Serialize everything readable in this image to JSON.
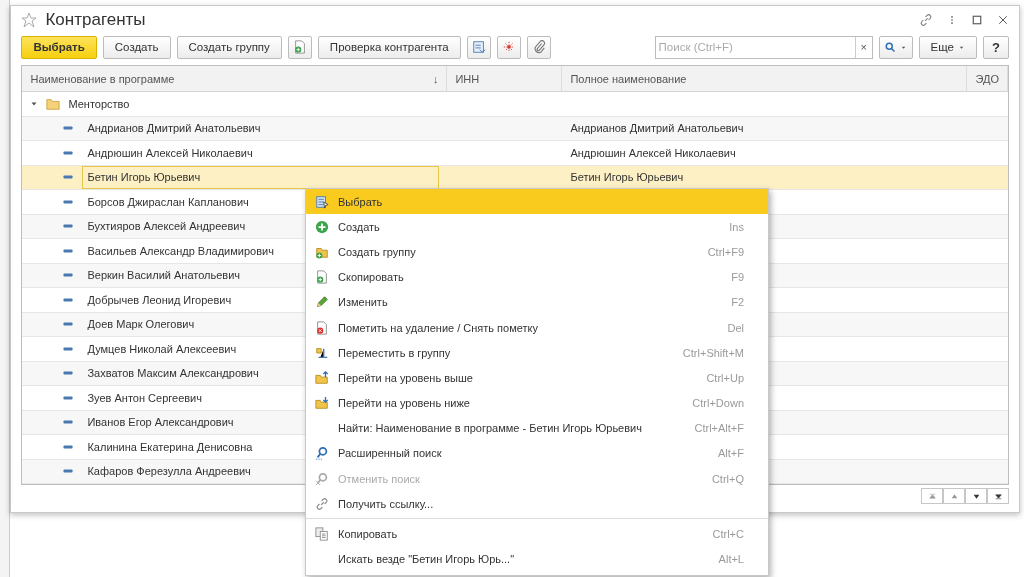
{
  "window": {
    "title": "Контрагенты",
    "favorite": false
  },
  "toolbar": {
    "buttons": [
      {
        "label": "Выбрать",
        "kind": "primary"
      },
      {
        "label": "Создать",
        "kind": "text"
      },
      {
        "label": "Создать группу",
        "kind": "text"
      },
      {
        "kind": "copy"
      },
      {
        "label": "Проверка контрагента",
        "kind": "text"
      },
      {
        "kind": "report"
      },
      {
        "kind": "structure"
      },
      {
        "kind": "attach"
      }
    ],
    "search": {
      "placeholder": "Поиск (Ctrl+F)",
      "clear": "×"
    },
    "more": "Еще",
    "help": "?"
  },
  "table": {
    "columns": [
      "Наименование в программе",
      "ИНН",
      "Полное наименование",
      "ЭДО"
    ],
    "sort_mark": "↓",
    "group": {
      "name": "Менторство",
      "expanded": true
    },
    "rows": [
      {
        "name": "Андрианов Дмитрий Анатольевич",
        "full": "Андрианов Дмитрий Анатольевич",
        "selected": false
      },
      {
        "name": "Андрюшин Алексей Николаевич",
        "full": "Андрюшин Алексей Николаевич",
        "selected": false
      },
      {
        "name": "Бетин Игорь Юрьевич",
        "full": "Бетин Игорь Юрьевич",
        "selected": true
      },
      {
        "name": "Борсов Джираслан Капланович",
        "selected": false
      },
      {
        "name": "Бухтияров Алексей Андреевич",
        "selected": false
      },
      {
        "name": "Васильев Александр Владимирович",
        "selected": false
      },
      {
        "name": "Веркин Василий Анатольевич",
        "selected": false
      },
      {
        "name": "Добрычев Леонид Игоревич",
        "selected": false
      },
      {
        "name": "Доев Марк Олегович",
        "selected": false
      },
      {
        "name": "Думцев Николай Алексеевич",
        "selected": false
      },
      {
        "name": "Захватов Максим Александрович",
        "selected": false
      },
      {
        "name": "Зуев Антон Сергеевич",
        "selected": false
      },
      {
        "name": "Иванов Егор Александрович",
        "selected": false
      },
      {
        "name": "Калинина Екатерина Денисовна",
        "selected": false
      },
      {
        "name": "Кафаров Ферезулла Андреевич",
        "selected": false
      }
    ]
  },
  "context_menu": [
    {
      "kind": "item",
      "label": "Выбрать",
      "selected": true,
      "disabled": false
    },
    {
      "kind": "item",
      "label": "Создать",
      "shortcut": "Ins",
      "selected": false,
      "disabled": false
    },
    {
      "kind": "item",
      "label": "Создать группу",
      "shortcut": "Ctrl+F9",
      "selected": false,
      "disabled": false
    },
    {
      "kind": "item",
      "label": "Скопировать",
      "shortcut": "F9",
      "selected": false,
      "disabled": false
    },
    {
      "kind": "item",
      "label": "Изменить",
      "shortcut": "F2",
      "selected": false,
      "disabled": false
    },
    {
      "kind": "item",
      "label": "Пометить на удаление / Снять пометку",
      "shortcut": "Del",
      "selected": false,
      "disabled": false
    },
    {
      "kind": "item",
      "label": "Переместить в группу",
      "shortcut": "Ctrl+Shift+M",
      "selected": false,
      "disabled": false
    },
    {
      "kind": "item",
      "label": "Перейти на уровень выше",
      "shortcut": "Ctrl+Up",
      "selected": false,
      "disabled": false
    },
    {
      "kind": "item",
      "label": "Перейти на уровень ниже",
      "shortcut": "Ctrl+Down",
      "selected": false,
      "disabled": false
    },
    {
      "kind": "item",
      "label": "Найти: Наименование в программе - Бетин Игорь Юрьевич",
      "shortcut": "Ctrl+Alt+F",
      "selected": false,
      "disabled": false
    },
    {
      "kind": "item",
      "label": "Расширенный поиск",
      "shortcut": "Alt+F",
      "selected": false,
      "disabled": false
    },
    {
      "kind": "item",
      "label": "Отменить поиск",
      "shortcut": "Ctrl+Q",
      "selected": false,
      "disabled": true
    },
    {
      "kind": "item",
      "label": "Получить ссылку...",
      "selected": false,
      "disabled": false
    },
    {
      "kind": "separator"
    },
    {
      "kind": "item",
      "label": "Копировать",
      "shortcut": "Ctrl+C",
      "selected": false,
      "disabled": false
    },
    {
      "kind": "item",
      "label": "Искать везде \"Бетин Игорь Юрь...\"",
      "shortcut": "Alt+L",
      "selected": false,
      "disabled": false
    }
  ]
}
